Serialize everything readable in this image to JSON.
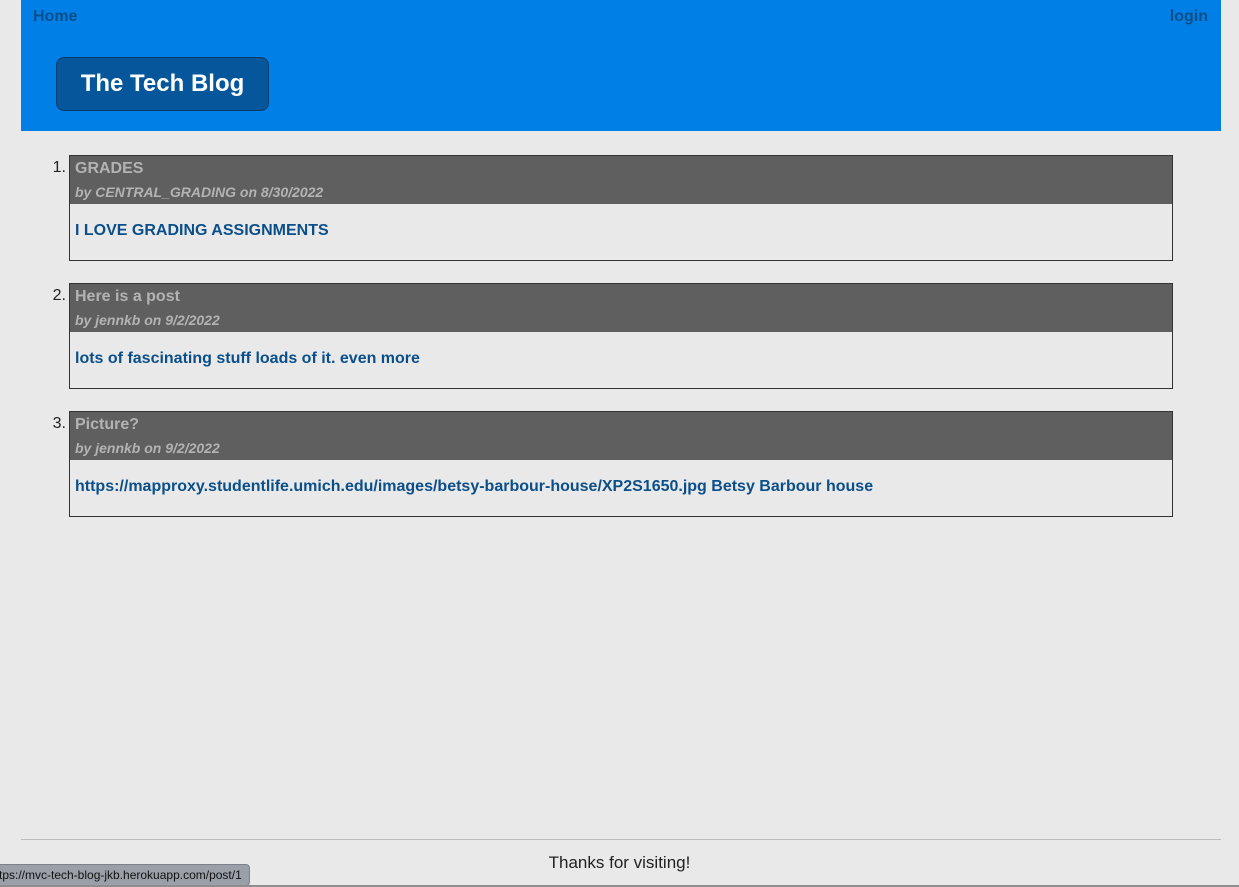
{
  "nav": {
    "home_label": "Home",
    "login_label": "login"
  },
  "site_title": "The Tech Blog",
  "posts": [
    {
      "number": "1.",
      "title": "GRADES",
      "meta": "by CENTRAL_GRADING on 8/30/2022",
      "body": "I LOVE GRADING ASSIGNMENTS"
    },
    {
      "number": "2.",
      "title": "Here is a post",
      "meta": "by jennkb on 9/2/2022",
      "body": "lots of fascinating stuff loads of it. even more"
    },
    {
      "number": "3.",
      "title": "Picture?",
      "meta": "by jennkb on 9/2/2022",
      "body": "https://mapproxy.studentlife.umich.edu/images/betsy-barbour-house/XP2S1650.jpg Betsy Barbour house"
    }
  ],
  "footer": {
    "text": "Thanks for visiting!"
  },
  "status_bar": {
    "url": "tps://mvc-tech-blog-jkb.herokuapp.com/post/1"
  },
  "colors": {
    "header_bg": "#0080e6",
    "title_bg": "#05569b",
    "post_head_bg": "#5f5f5f",
    "link_color": "#0b4f8a",
    "page_bg": "#e9e9e9"
  }
}
